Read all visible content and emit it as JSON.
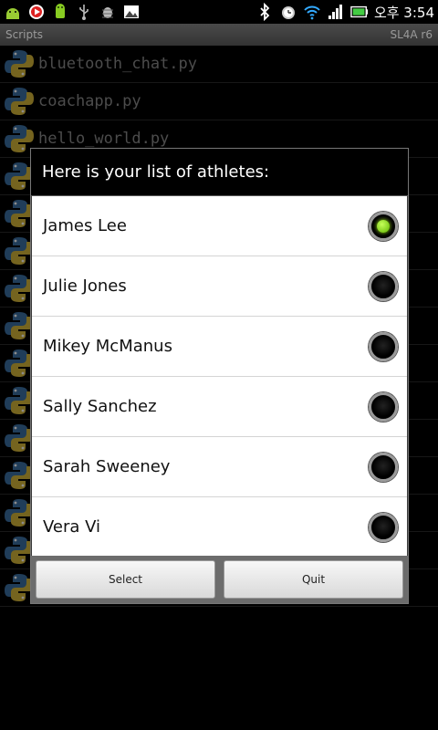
{
  "status_bar": {
    "time": "오후 3:54",
    "left_icons": [
      "android-icon",
      "youtube-icon",
      "android-update-icon",
      "usb-icon",
      "bug-icon",
      "picture-icon"
    ],
    "right_icons": [
      "bluetooth-icon",
      "alarm-icon",
      "wifi-icon",
      "signal-icon",
      "battery-icon"
    ]
  },
  "title_bar": {
    "title": "Scripts",
    "version": "SL4A r6"
  },
  "scripts": [
    "bluetooth_chat.py",
    "coachapp.py",
    "hello_world.py",
    "",
    "",
    "",
    "",
    "",
    "",
    "",
    "",
    "",
    "",
    "",
    ""
  ],
  "dialog": {
    "title": "Here is your list of athletes:",
    "athletes": [
      {
        "name": "James Lee",
        "selected": true
      },
      {
        "name": "Julie Jones",
        "selected": false
      },
      {
        "name": "Mikey McManus",
        "selected": false
      },
      {
        "name": "Sally Sanchez",
        "selected": false
      },
      {
        "name": "Sarah Sweeney",
        "selected": false
      },
      {
        "name": "Vera Vi",
        "selected": false
      }
    ],
    "select_label": "Select",
    "quit_label": "Quit"
  },
  "colors": {
    "radio_selected": "#7ed321",
    "dialog_bg": "#ffffff",
    "header_bg": "#000000"
  }
}
